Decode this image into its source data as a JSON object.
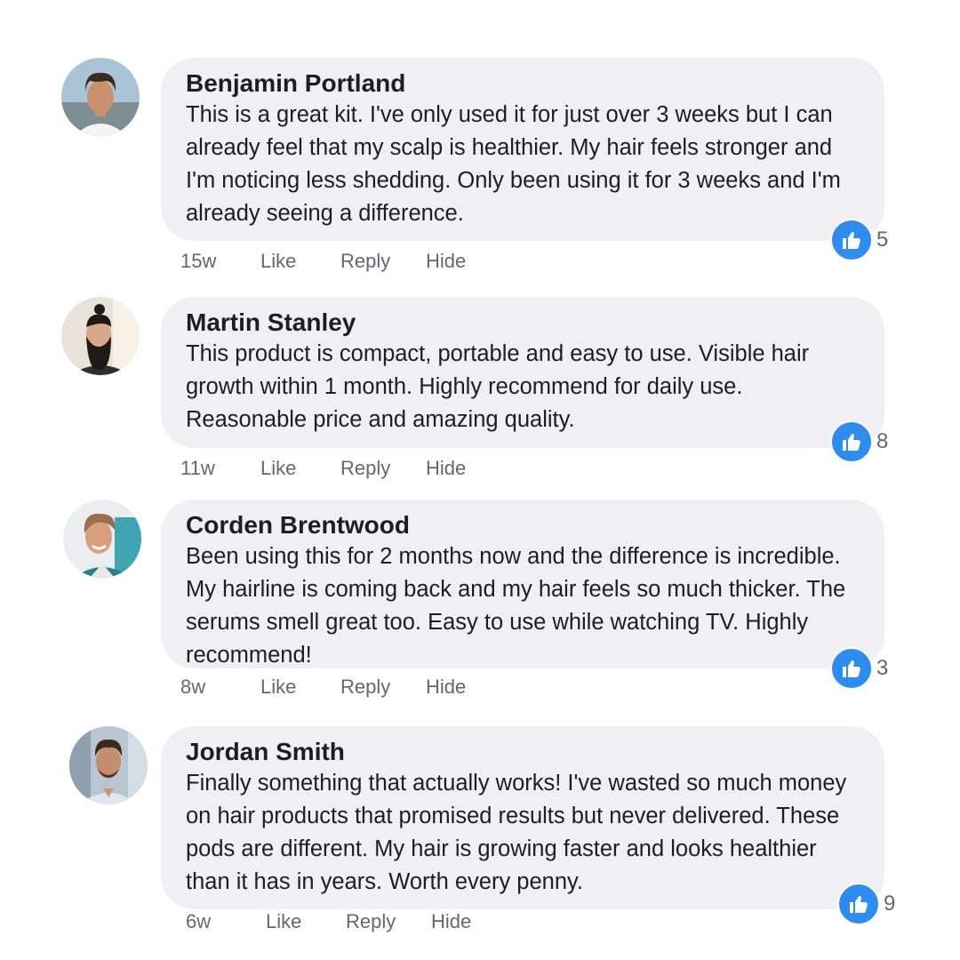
{
  "comments": [
    {
      "author": "Benjamin Portland",
      "text": "This is a great kit. I've only used it for just over 3 weeks but I can already feel that my scalp is healthier. My hair feels stronger and I'm noticing less shedding. Only been using it for 3 weeks and I'm already seeing a difference.",
      "time": "15w",
      "like_label": "Like",
      "reply_label": "Reply",
      "hide_label": "Hide",
      "reactions": "5"
    },
    {
      "author": "Martin Stanley",
      "text": "This product is compact, portable and easy to use. Visible hair growth within 1 month. Highly recommend for daily use. Reasonable price and amazing quality.",
      "time": "11w",
      "like_label": "Like",
      "reply_label": "Reply",
      "hide_label": "Hide",
      "reactions": "8"
    },
    {
      "author": "Corden Brentwood",
      "text": "Been using this for 2 months now and the difference is incredible. My hairline is coming back and my hair feels so much thicker. The serums smell great too. Easy to use while watching TV. Highly recommend!",
      "time": "8w",
      "like_label": "Like",
      "reply_label": "Reply",
      "hide_label": "Hide",
      "reactions": "3"
    },
    {
      "author": "Jordan Smith",
      "text": "Finally something that actually works! I've wasted so much money on hair products that promised results but never delivered. These pods are different. My hair is growing faster and looks healthier than it has in years. Worth every penny.",
      "time": "6w",
      "like_label": "Like",
      "reply_label": "Reply",
      "hide_label": "Hide",
      "reactions": "9"
    }
  ],
  "colors": {
    "bubble": "#f0f0f4",
    "like_badge": "#2d8cf0",
    "meta_text": "#65676b"
  },
  "icons": {
    "reaction": "thumbs-up-icon"
  }
}
